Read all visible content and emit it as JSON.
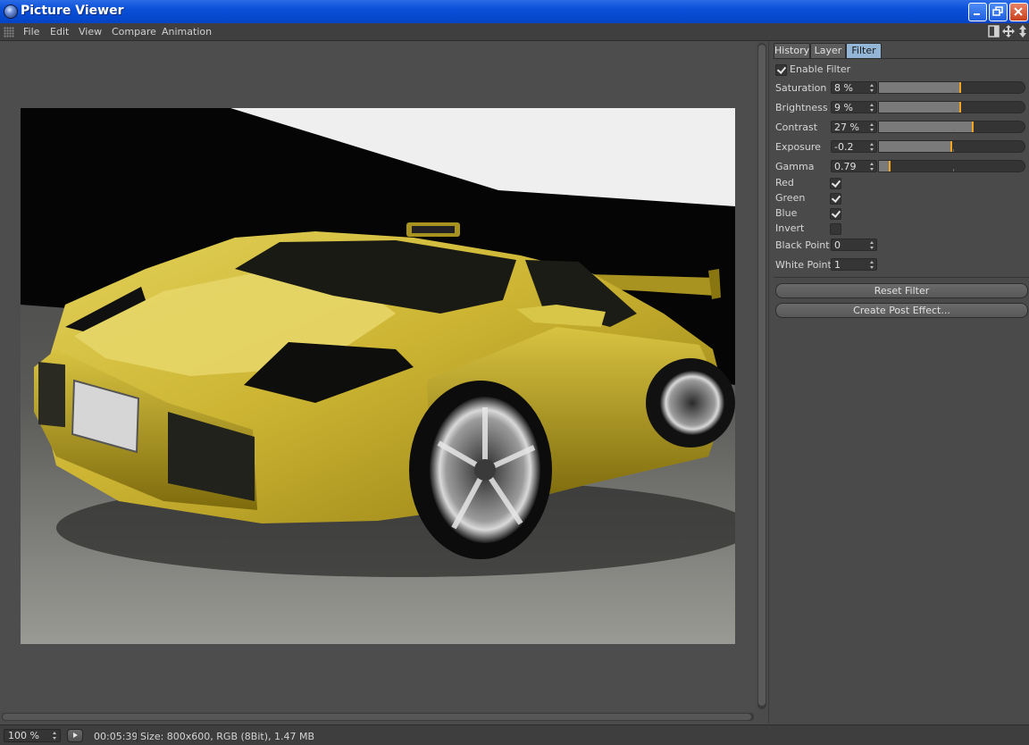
{
  "window": {
    "title": "Picture Viewer"
  },
  "menu": [
    "File",
    "Edit",
    "View",
    "Compare",
    "Animation"
  ],
  "tabs": [
    {
      "label": "History",
      "active": false
    },
    {
      "label": "Layer",
      "active": false
    },
    {
      "label": "Filter",
      "active": true
    }
  ],
  "filter": {
    "enable_label": "Enable Filter",
    "enable_checked": true,
    "sliders": [
      {
        "label": "Saturation",
        "value": "8 %",
        "fraction": 0.55
      },
      {
        "label": "Brightness",
        "value": "9 %",
        "fraction": 0.55
      },
      {
        "label": "Contrast",
        "value": "27 %",
        "fraction": 0.64
      },
      {
        "label": "Exposure",
        "value": "-0.2",
        "fraction": 0.49
      },
      {
        "label": "Gamma",
        "value": "0.79",
        "fraction": 0.07
      }
    ],
    "channels": [
      {
        "label": "Red",
        "checked": true
      },
      {
        "label": "Green",
        "checked": true
      },
      {
        "label": "Blue",
        "checked": true
      },
      {
        "label": "Invert",
        "checked": false
      }
    ],
    "black_point_label": "Black Point",
    "black_point_value": "0",
    "white_point_label": "White Point",
    "white_point_value": "1",
    "reset_button": "Reset Filter",
    "post_effect_button": "Create Post Effect..."
  },
  "status": {
    "zoom": "100 %",
    "time": "00:05:39",
    "info": "Size: 800x600, RGB (8Bit), 1.47 MB"
  },
  "colors": {
    "titlebar": "#0a4fd8",
    "active_tab": "#93b6d6",
    "slider_knob": "#f2a51f",
    "car_body": "#c9b330"
  }
}
